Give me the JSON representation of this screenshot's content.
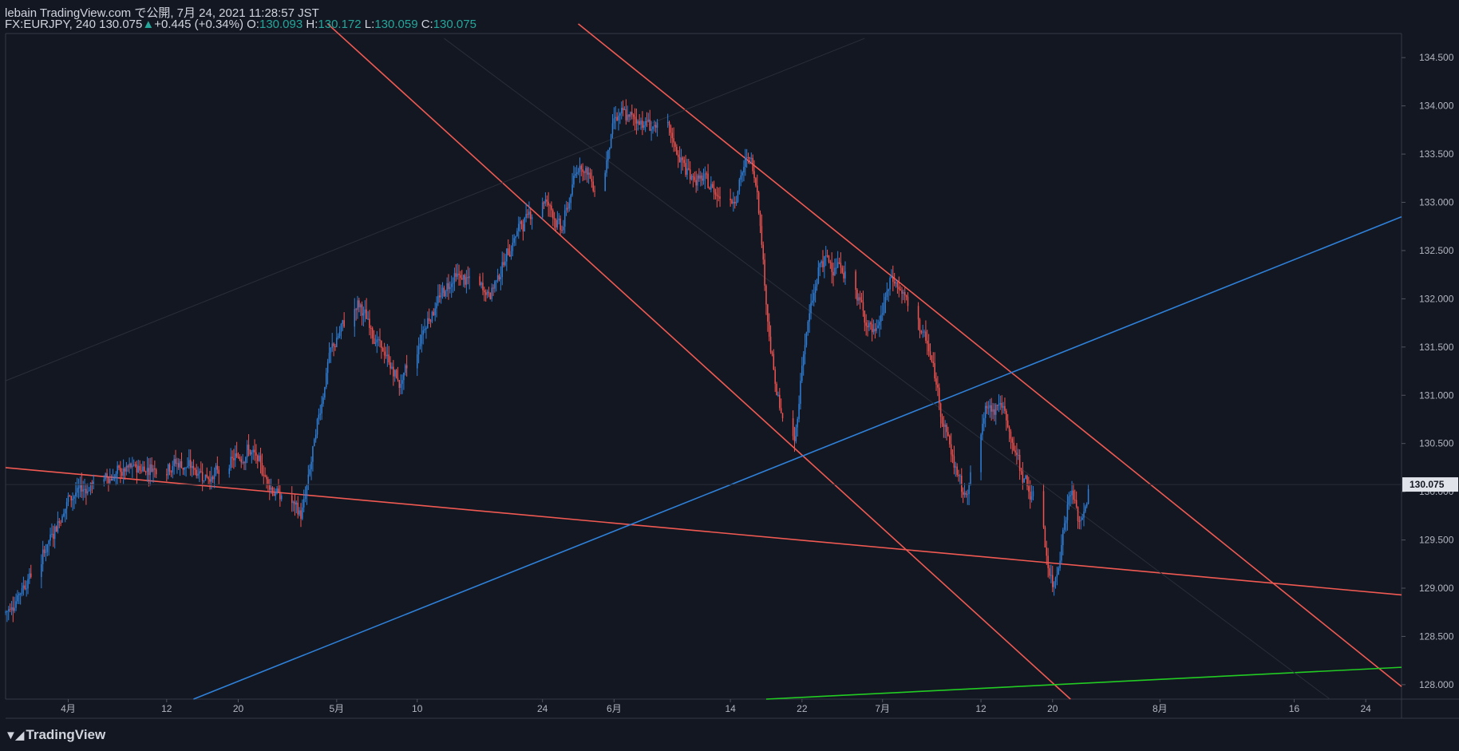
{
  "header": {
    "line1": "lebain TradingView.com で公開, 7月 24, 2021 11:28:57 JST",
    "symbol": "FX:EURJPY, 240",
    "last": "130.075",
    "arrow": "▲",
    "change": "+0.445 (+0.34%)",
    "o_label": "O:",
    "o_value": "130.093",
    "h_label": "H:",
    "h_value": "130.172",
    "l_label": "L:",
    "l_value": "130.059",
    "c_label": "C:",
    "c_value": "130.075"
  },
  "footer": {
    "brand": "TradingView",
    "logo_icon": "tradingview-logo-icon"
  },
  "colors": {
    "background": "#131722",
    "up": "#26a69a",
    "candle_up": "#2f7fd8",
    "candle_down": "#ef5350",
    "trend_red": "#f15a52",
    "trend_blue": "#2f80d8",
    "trend_green": "#22cc22",
    "axis_text": "#b2b5be"
  },
  "chart_data": {
    "type": "candlestick",
    "symbol": "FX:EURJPY",
    "interval": "240",
    "ylim": [
      127.85,
      134.75
    ],
    "y_ticks": [
      "134.500",
      "134.000",
      "133.500",
      "133.000",
      "132.500",
      "132.000",
      "131.500",
      "131.000",
      "130.500",
      "130.000",
      "129.500",
      "129.000",
      "128.500",
      "128.000"
    ],
    "x_ticks": [
      "4月",
      "12",
      "20",
      "5月",
      "10",
      "24",
      "6月",
      "14",
      "22",
      "7月",
      "12",
      "20",
      "8月",
      "16",
      "24"
    ],
    "last_price_label": "130.075",
    "last_price": 130.075,
    "close_path": [
      {
        "date": "2021-03-25",
        "close": 128.75
      },
      {
        "date": "2021-03-29",
        "close": 129.35
      },
      {
        "date": "2021-04-01",
        "close": 129.95
      },
      {
        "date": "2021-04-05",
        "close": 130.15
      },
      {
        "date": "2021-04-09",
        "close": 130.25
      },
      {
        "date": "2021-04-13",
        "close": 130.3
      },
      {
        "date": "2021-04-17",
        "close": 130.15
      },
      {
        "date": "2021-04-21",
        "close": 130.45
      },
      {
        "date": "2021-04-24",
        "close": 130.0
      },
      {
        "date": "2021-04-27",
        "close": 129.75
      },
      {
        "date": "2021-04-30",
        "close": 131.4
      },
      {
        "date": "2021-05-03",
        "close": 132.0
      },
      {
        "date": "2021-05-06",
        "close": 131.45
      },
      {
        "date": "2021-05-08",
        "close": 131.1
      },
      {
        "date": "2021-05-11",
        "close": 131.8
      },
      {
        "date": "2021-05-14",
        "close": 132.25
      },
      {
        "date": "2021-05-18",
        "close": 132.05
      },
      {
        "date": "2021-05-21",
        "close": 132.7
      },
      {
        "date": "2021-05-24",
        "close": 133.1
      },
      {
        "date": "2021-05-26",
        "close": 132.7
      },
      {
        "date": "2021-05-28",
        "close": 133.45
      },
      {
        "date": "2021-05-30",
        "close": 133.1
      },
      {
        "date": "2021-06-01",
        "close": 133.9
      },
      {
        "date": "2021-06-04",
        "close": 133.85
      },
      {
        "date": "2021-06-07",
        "close": 133.7
      },
      {
        "date": "2021-06-09",
        "close": 133.3
      },
      {
        "date": "2021-06-11",
        "close": 133.2
      },
      {
        "date": "2021-06-14",
        "close": 133.0
      },
      {
        "date": "2021-06-16",
        "close": 133.5
      },
      {
        "date": "2021-06-17",
        "close": 133.1
      },
      {
        "date": "2021-06-18",
        "close": 131.8
      },
      {
        "date": "2021-06-19",
        "close": 131.0
      },
      {
        "date": "2021-06-21",
        "close": 130.3
      },
      {
        "date": "2021-06-22",
        "close": 131.5
      },
      {
        "date": "2021-06-24",
        "close": 132.4
      },
      {
        "date": "2021-06-26",
        "close": 132.35
      },
      {
        "date": "2021-06-28",
        "close": 132.0
      },
      {
        "date": "2021-06-30",
        "close": 131.6
      },
      {
        "date": "2021-07-02",
        "close": 132.25
      },
      {
        "date": "2021-07-04",
        "close": 131.85
      },
      {
        "date": "2021-07-06",
        "close": 131.5
      },
      {
        "date": "2021-07-08",
        "close": 130.6
      },
      {
        "date": "2021-07-10",
        "close": 129.9
      },
      {
        "date": "2021-07-12",
        "close": 130.8
      },
      {
        "date": "2021-07-14",
        "close": 130.95
      },
      {
        "date": "2021-07-16",
        "close": 130.3
      },
      {
        "date": "2021-07-18",
        "close": 129.85
      },
      {
        "date": "2021-07-19",
        "close": 129.4
      },
      {
        "date": "2021-07-20",
        "close": 128.95
      },
      {
        "date": "2021-07-21",
        "close": 129.6
      },
      {
        "date": "2021-07-22",
        "close": 130.05
      },
      {
        "date": "2021-07-23",
        "close": 129.6
      },
      {
        "date": "2021-07-24",
        "close": 130.075
      }
    ],
    "trend_lines": [
      {
        "color": "red",
        "from": {
          "date": "2021-03-25",
          "price": 130.25
        },
        "to": {
          "date": "2021-08-28",
          "price": 128.93
        }
      },
      {
        "color": "red",
        "from": {
          "date": "2021-04-30",
          "price": 134.85
        },
        "to": {
          "date": "2021-07-22",
          "price": 127.85
        }
      },
      {
        "color": "red",
        "from": {
          "date": "2021-05-28",
          "price": 134.85
        },
        "to": {
          "date": "2021-08-28",
          "price": 127.98
        }
      },
      {
        "color": "blue",
        "from": {
          "date": "2021-04-15",
          "price": 127.85
        },
        "to": {
          "date": "2021-08-28",
          "price": 132.85
        }
      },
      {
        "color": "green",
        "from": {
          "date": "2021-06-18",
          "price": 127.85
        },
        "to": {
          "date": "2021-08-28",
          "price": 128.18
        }
      },
      {
        "color": "faint",
        "from": {
          "date": "2021-03-25",
          "price": 131.15
        },
        "to": {
          "date": "2021-06-29",
          "price": 134.7
        }
      },
      {
        "color": "faint",
        "from": {
          "date": "2021-05-13",
          "price": 134.7
        },
        "to": {
          "date": "2021-08-20",
          "price": 127.85
        }
      }
    ]
  }
}
